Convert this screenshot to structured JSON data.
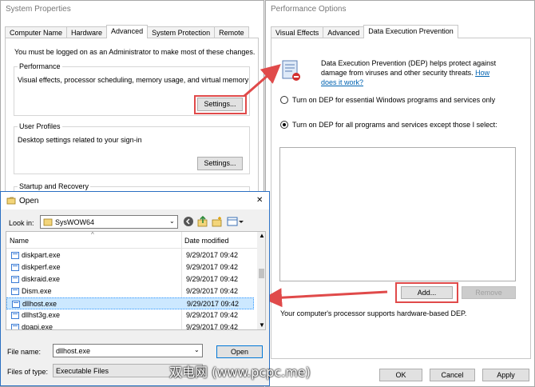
{
  "system_properties": {
    "title": "System Properties",
    "tabs": [
      "Computer Name",
      "Hardware",
      "Advanced",
      "System Protection",
      "Remote"
    ],
    "admin_note": "You must be logged on as an Administrator to make most of these changes.",
    "performance": {
      "label": "Performance",
      "desc": "Visual effects, processor scheduling, memory usage, and virtual memory",
      "button": "Settings..."
    },
    "user_profiles": {
      "label": "User Profiles",
      "desc": "Desktop settings related to your sign-in",
      "button": "Settings..."
    },
    "startup": {
      "label": "Startup and Recovery"
    }
  },
  "performance_options": {
    "title": "Performance Options",
    "tabs": [
      "Visual Effects",
      "Advanced",
      "Data Execution Prevention"
    ],
    "dep_desc_1": "Data Execution Prevention (DEP) helps protect against",
    "dep_desc_2": "damage from viruses and other security threats.",
    "dep_link_1": "How",
    "dep_link_2": "does it work?",
    "option_essential": "Turn on DEP for essential Windows programs and services only",
    "option_all": "Turn on DEP for all programs and services except those I select:",
    "add_button": "Add...",
    "remove_button": "Remove",
    "support_note": "Your computer's processor supports hardware-based DEP.",
    "ok_button": "OK",
    "cancel_button": "Cancel",
    "apply_button": "Apply"
  },
  "open_dialog": {
    "title": "Open",
    "close_glyph": "✕",
    "look_in_label": "Look in:",
    "look_in_value": "SysWOW64",
    "col_name": "Name",
    "col_date": "Date modified",
    "files": [
      {
        "name": "diskpart.exe",
        "date": "9/29/2017 09:42"
      },
      {
        "name": "diskperf.exe",
        "date": "9/29/2017 09:42"
      },
      {
        "name": "diskraid.exe",
        "date": "9/29/2017 09:42"
      },
      {
        "name": "Dism.exe",
        "date": "9/29/2017 09:42"
      },
      {
        "name": "dllhost.exe",
        "date": "9/29/2017 09:42"
      },
      {
        "name": "dllhst3g.exe",
        "date": "9/29/2017 09:42"
      },
      {
        "name": "dpapi.exe",
        "date": "9/29/2017 09:42"
      }
    ],
    "file_name_label": "File name:",
    "file_name_value": "dllhost.exe",
    "files_of_type_label": "Files of type:",
    "files_of_type_value": "Executable Files",
    "open_button": "Open"
  },
  "watermark": "双电网 (www.pcpc.me)"
}
